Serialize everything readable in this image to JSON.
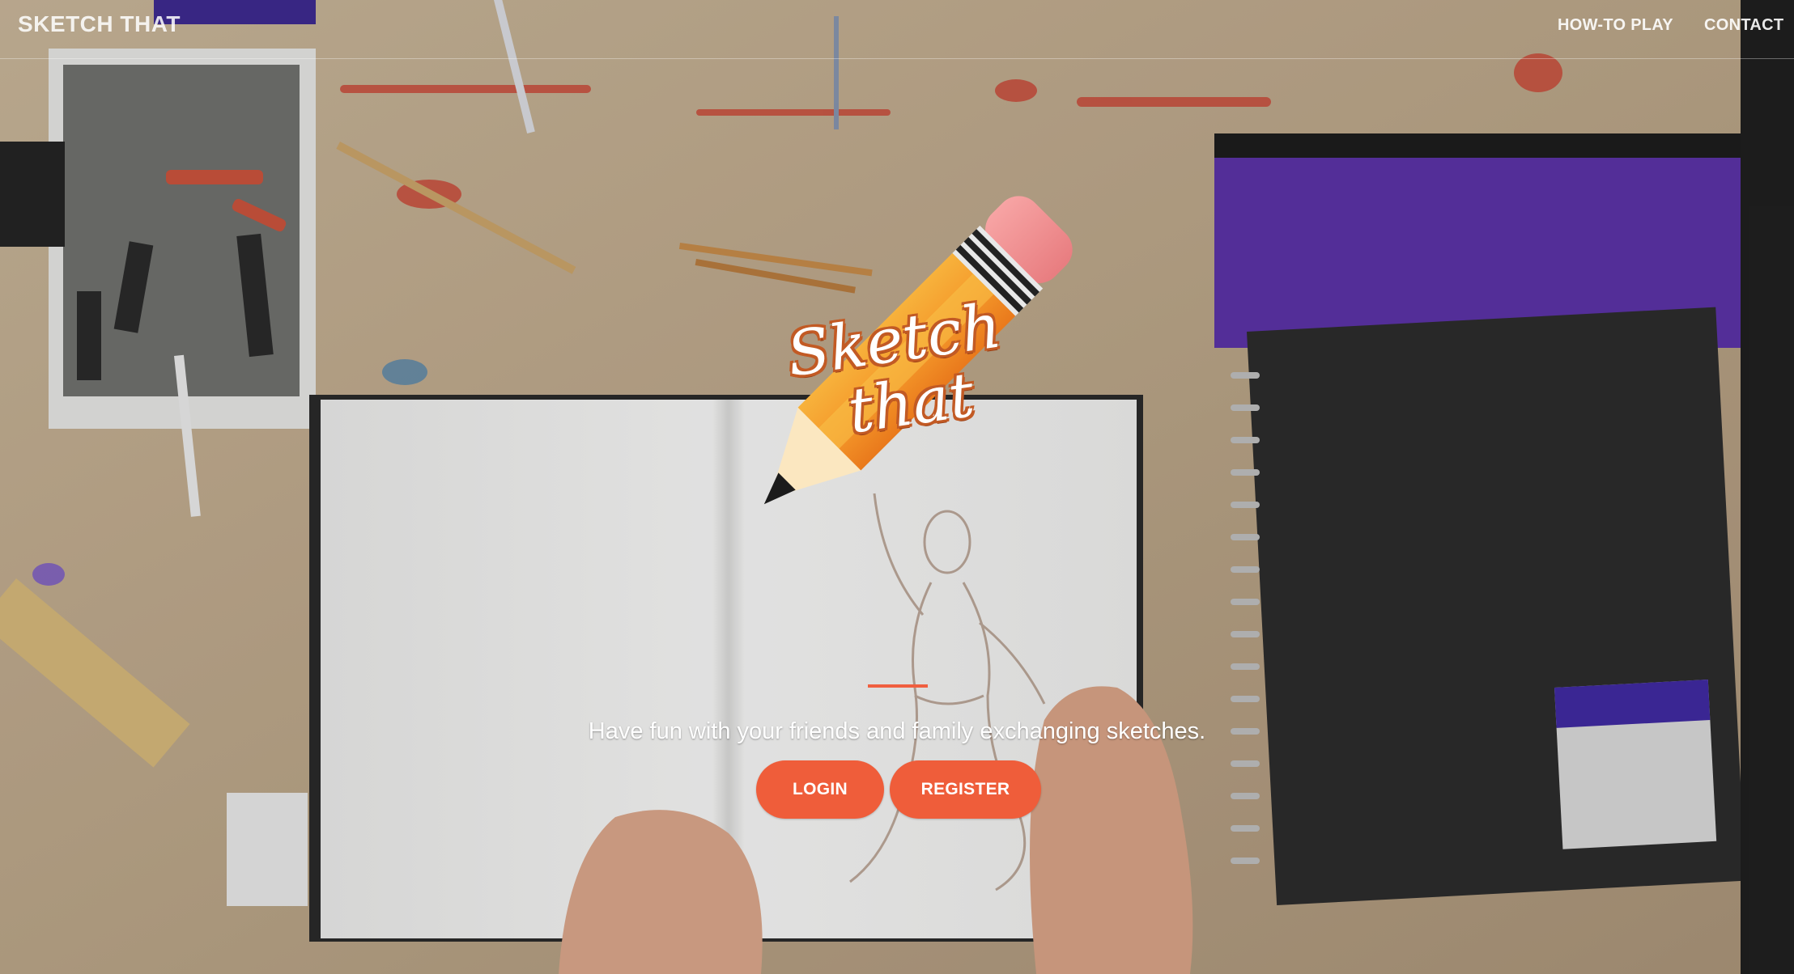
{
  "navbar": {
    "brand": "SKETCH THAT",
    "links": [
      {
        "label": "HOW-TO PLAY"
      },
      {
        "label": "CONTACT"
      }
    ]
  },
  "hero": {
    "logo_line1": "Sketch",
    "logo_line2": "that",
    "tagline": "Have fun with your friends and family exchanging sketches.",
    "login_label": "LOGIN",
    "register_label": "REGISTER"
  },
  "colors": {
    "accent": "#f05f40",
    "button": "#ef5d3a"
  },
  "icons": [
    "pencil-logo-icon"
  ]
}
